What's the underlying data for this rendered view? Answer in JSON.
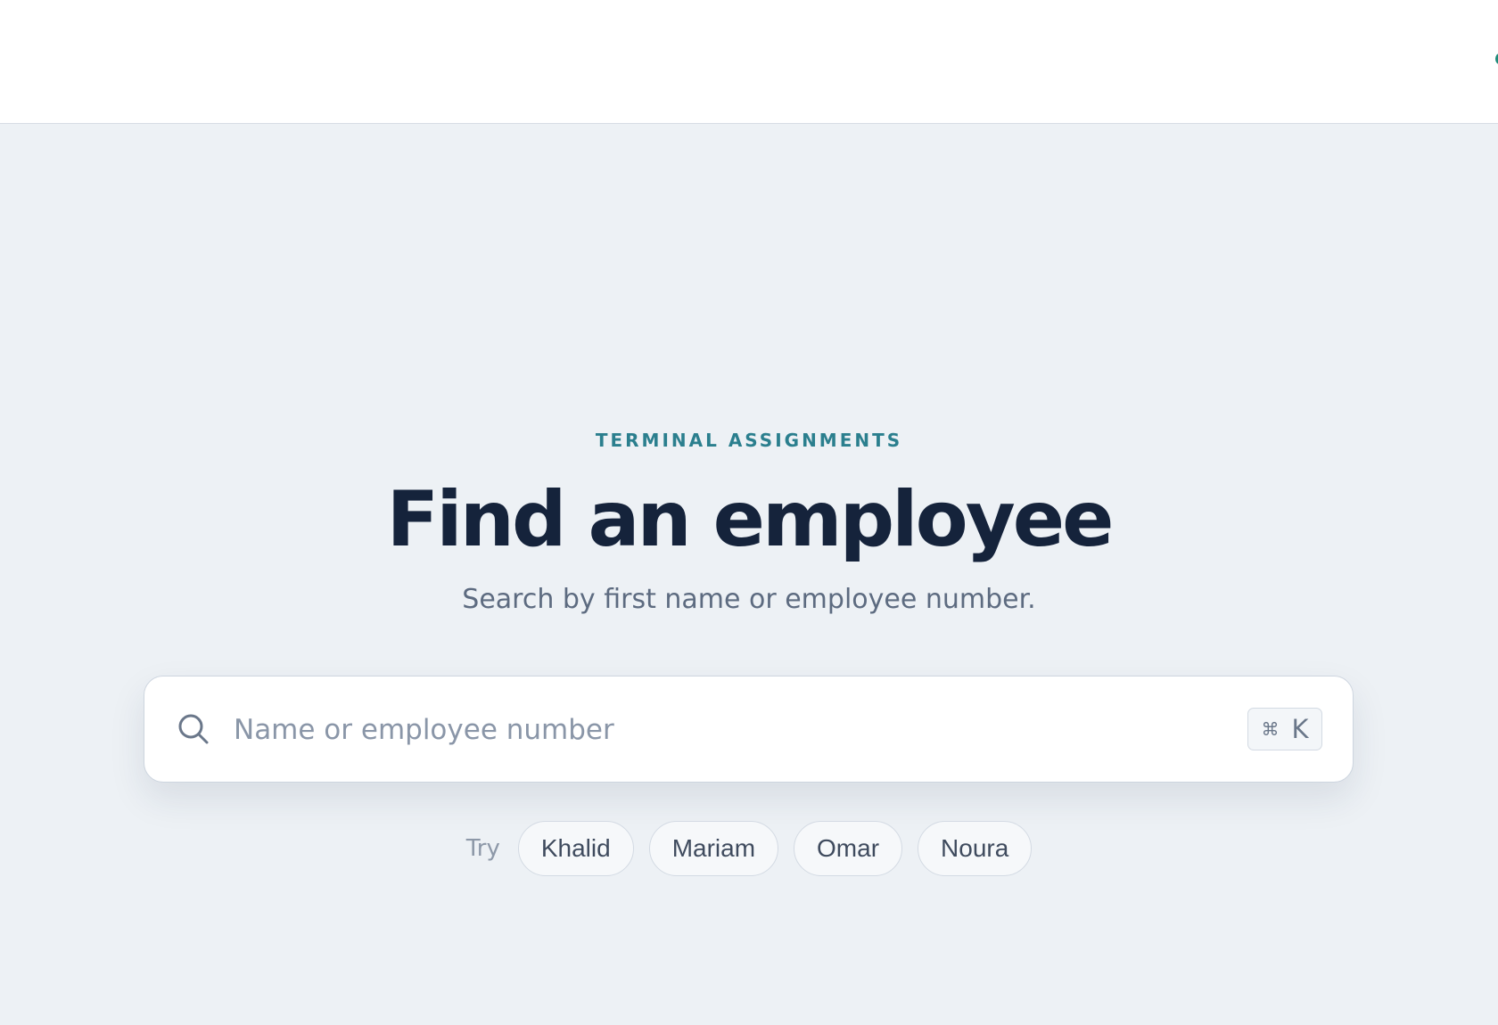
{
  "hero": {
    "eyebrow": "TERMINAL ASSIGNMENTS",
    "title": "Find an employee",
    "subtitle": "Search by first name or employee number."
  },
  "search": {
    "placeholder": "Name or employee number",
    "value": "",
    "shortcut_modifier": "⌘",
    "shortcut_key": "K"
  },
  "suggestions": {
    "label": "Try",
    "chips": [
      "Khalid",
      "Mariam",
      "Omar",
      "Noura"
    ]
  },
  "colors": {
    "accent": "#2b7f8e",
    "title": "#15233b",
    "background": "#edf1f5"
  }
}
